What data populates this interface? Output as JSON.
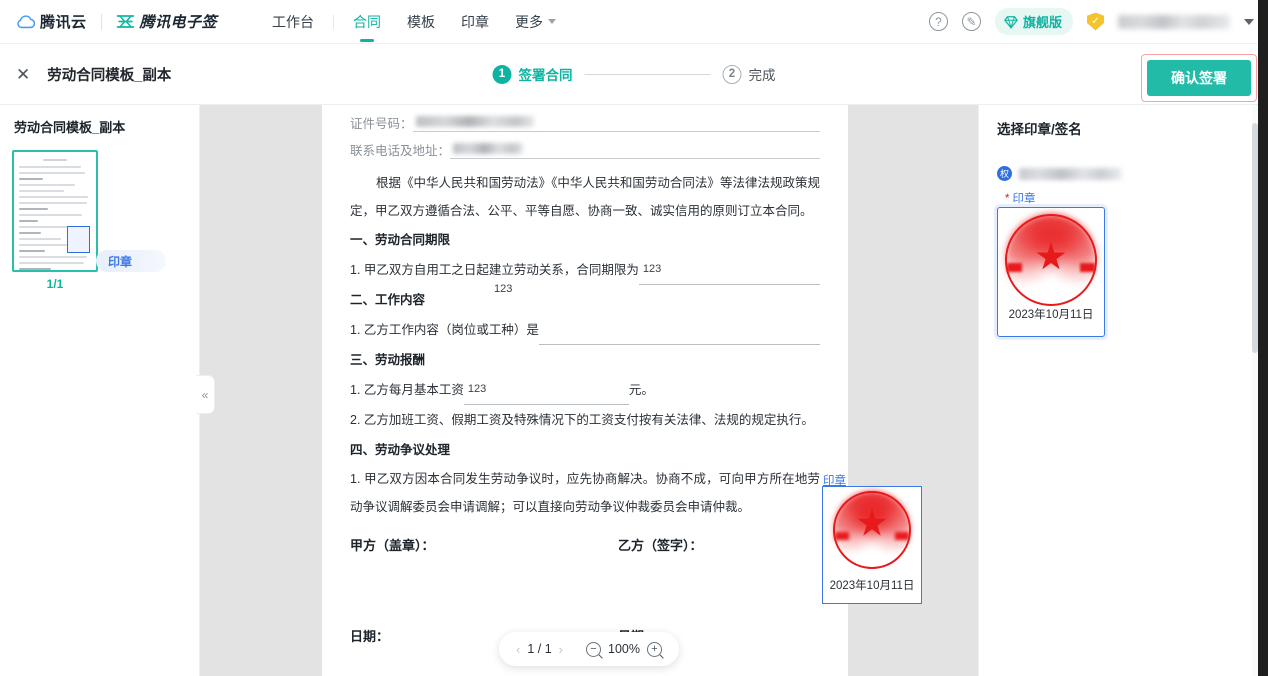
{
  "topnav": {
    "brand_primary": "腾讯云",
    "brand_secondary": "腾讯电子签",
    "menu": [
      {
        "label": "工作台",
        "active": false
      },
      {
        "label": "合同",
        "active": true
      },
      {
        "label": "模板",
        "active": false
      },
      {
        "label": "印章",
        "active": false
      },
      {
        "label": "更多",
        "active": false,
        "has_caret": true
      }
    ],
    "help_icon": "question-mark-icon",
    "feedback_icon": "pen-circle-icon",
    "vip_label": "旗舰版",
    "vip_icon": "diamond-icon",
    "shield_icon": "shield-check-icon",
    "user_name_blurred": true,
    "user_caret": "chevron-down-icon"
  },
  "subheader": {
    "close_icon": "close-icon",
    "doc_title": "劳动合同模板_副本",
    "steps": [
      {
        "num": "1",
        "label": "签署合同",
        "state": "active"
      },
      {
        "num": "2",
        "label": "完成",
        "state": "idle"
      }
    ],
    "confirm_label": "确认签署"
  },
  "left_sidebar": {
    "title": "劳动合同模板_副本",
    "page_indicator": "1/1",
    "tag_label": "印章",
    "collapse_icon": "double-chevron-left-icon"
  },
  "document": {
    "fields": [
      {
        "label": "证件号码：",
        "value_blurred": true
      },
      {
        "label": "联系电话及地址：",
        "value_blurred": true
      }
    ],
    "intro": "根据《中华人民共和国劳动法》《中华人民共和国劳动合同法》等法律法规政策规定，甲乙双方遵循合法、公平、平等自愿、协商一致、诚实信用的原则订立本合同。",
    "sections": [
      {
        "heading": "一、劳动合同期限",
        "items": [
          {
            "prefix": "1. 甲乙双方自用工之日起建立劳动关系，合同期限为",
            "fill": "123",
            "suffix": ""
          }
        ]
      },
      {
        "heading": "二、工作内容",
        "items": [
          {
            "prefix": "1. 乙方工作内容（岗位或工种）是",
            "fill": "",
            "suffix": ""
          }
        ]
      },
      {
        "heading": "三、劳动报酬",
        "items": [
          {
            "prefix": "1. 乙方每月基本工资",
            "fill": "123",
            "suffix": "元。"
          },
          {
            "prefix": "2. 乙方加班工资、假期工资及特殊情况下的工资支付按有关法律、法规的规定执行。",
            "fill": "",
            "suffix": ""
          }
        ]
      },
      {
        "heading": "四、劳动争议处理",
        "items": [
          {
            "prefix": "1. 甲乙双方因本合同发生劳动争议时，应先协商解决。协商不成，可向甲方所在地劳动争议调解委员会申请调解；可以直接向劳动争议仲裁委员会申请仲裁。",
            "fill": "",
            "suffix": ""
          }
        ]
      }
    ],
    "floating_fill": "123",
    "signature_row": {
      "party_a": "甲方（盖章）：",
      "party_b": "乙方（签字）："
    },
    "date_row": {
      "party_a": "日期：",
      "party_b": "日期："
    },
    "placed_seal": {
      "label": "印章",
      "date": "2023年10月11日",
      "stamp_color": "#e8191b",
      "border_color": "#3b79e8"
    }
  },
  "toolbar": {
    "prev_icon": "chevron-left-icon",
    "page_text": "1 / 1",
    "next_icon": "chevron-right-icon",
    "zoom_out_icon": "magnifier-minus-icon",
    "zoom_level": "100%",
    "zoom_in_icon": "magnifier-plus-icon"
  },
  "right_panel": {
    "title": "选择印章/签名",
    "org_badge_text": "权",
    "org_name_blurred": true,
    "seal_required_star": "*",
    "seal_required_label": "印章",
    "seal_card": {
      "date": "2023年10月11日",
      "selected": true,
      "border_color": "#3b79e8"
    }
  },
  "colors": {
    "accent_teal": "#0fb3a1",
    "button_teal": "#21bba8",
    "link_blue": "#3b79e8",
    "stamp_red": "#e8191b",
    "highlight_border": "#f6a2a8"
  }
}
